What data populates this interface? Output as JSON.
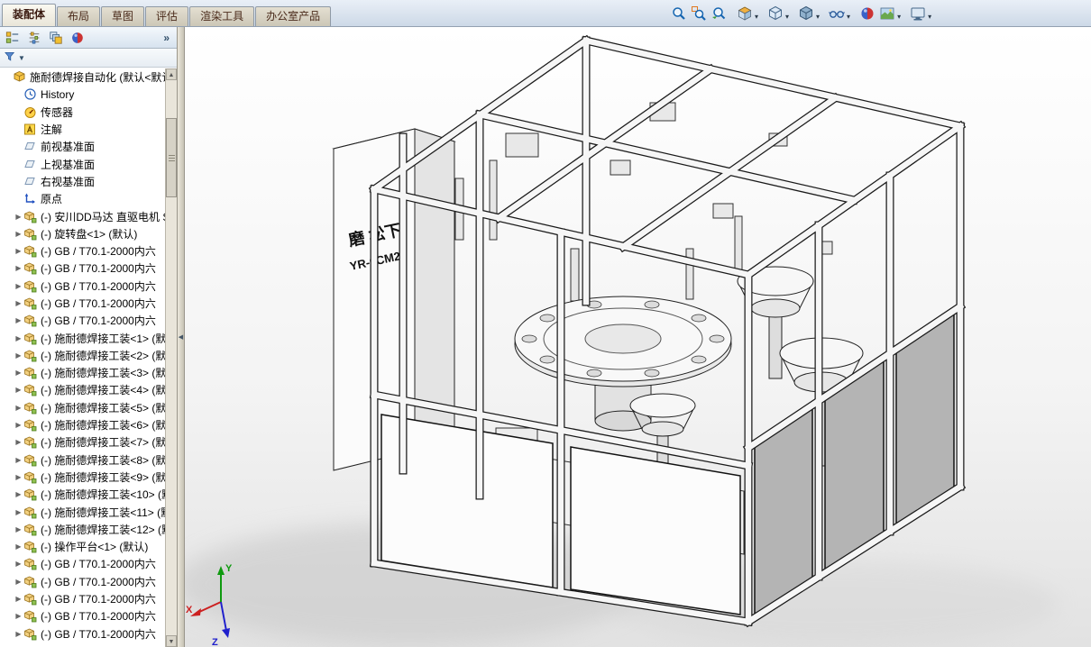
{
  "tabs": {
    "items": [
      {
        "label": "装配体",
        "active": true
      },
      {
        "label": "布局",
        "active": false
      },
      {
        "label": "草图",
        "active": false
      },
      {
        "label": "评估",
        "active": false
      },
      {
        "label": "渲染工具",
        "active": false
      },
      {
        "label": "办公室产品",
        "active": false
      }
    ]
  },
  "heads_up_toolbar": {
    "buttons": [
      {
        "icon": "zoom-fit",
        "caret": false,
        "gap": false
      },
      {
        "icon": "zoom-area",
        "caret": false,
        "gap": false
      },
      {
        "icon": "zoom-previous",
        "caret": false,
        "gap": false
      },
      {
        "icon": "section-view",
        "caret": true,
        "gap": true
      },
      {
        "icon": "view-orientation",
        "caret": true,
        "gap": true
      },
      {
        "icon": "display-style",
        "caret": true,
        "gap": true
      },
      {
        "icon": "hide-show-items",
        "caret": true,
        "gap": true
      },
      {
        "icon": "edit-appearance",
        "caret": false,
        "gap": true
      },
      {
        "icon": "apply-scene",
        "caret": true,
        "gap": false
      },
      {
        "icon": "view-settings",
        "caret": true,
        "gap": true
      }
    ]
  },
  "panel": {
    "header": {
      "icons": [
        "featuremanager-tree",
        "propertymanager",
        "configurationmanager",
        "appearance-manager"
      ],
      "overflow_label": "»"
    },
    "tree": {
      "items": [
        {
          "icon": "assembly",
          "label": "施耐德焊接自动化 (默认<默认",
          "indent": 0,
          "arrow": false
        },
        {
          "icon": "history",
          "label": "History",
          "indent": 1,
          "arrow": false
        },
        {
          "icon": "sensor",
          "label": "传感器",
          "indent": 1,
          "arrow": false
        },
        {
          "icon": "annotations",
          "label": "注解",
          "indent": 1,
          "arrow": false
        },
        {
          "icon": "plane",
          "label": "前视基准面",
          "indent": 1,
          "arrow": false
        },
        {
          "icon": "plane",
          "label": "上视基准面",
          "indent": 1,
          "arrow": false
        },
        {
          "icon": "plane",
          "label": "右视基准面",
          "indent": 1,
          "arrow": false
        },
        {
          "icon": "origin",
          "label": "原点",
          "indent": 1,
          "arrow": false
        },
        {
          "icon": "component",
          "label": "(-) 安川DD马达 直驱电机 S",
          "indent": 1,
          "arrow": true
        },
        {
          "icon": "component",
          "label": "(-) 旋转盘<1> (默认)",
          "indent": 1,
          "arrow": true
        },
        {
          "icon": "component",
          "label": "(-) GB / T70.1-2000内六",
          "indent": 1,
          "arrow": true
        },
        {
          "icon": "component",
          "label": "(-) GB / T70.1-2000内六",
          "indent": 1,
          "arrow": true
        },
        {
          "icon": "component",
          "label": "(-) GB / T70.1-2000内六",
          "indent": 1,
          "arrow": true
        },
        {
          "icon": "component",
          "label": "(-) GB / T70.1-2000内六",
          "indent": 1,
          "arrow": true
        },
        {
          "icon": "component",
          "label": "(-) GB / T70.1-2000内六",
          "indent": 1,
          "arrow": true
        },
        {
          "icon": "component",
          "label": "(-) 施耐德焊接工装<1> (默",
          "indent": 1,
          "arrow": true
        },
        {
          "icon": "component",
          "label": "(-) 施耐德焊接工装<2> (默",
          "indent": 1,
          "arrow": true
        },
        {
          "icon": "component",
          "label": "(-) 施耐德焊接工装<3> (默",
          "indent": 1,
          "arrow": true
        },
        {
          "icon": "component",
          "label": "(-) 施耐德焊接工装<4> (默",
          "indent": 1,
          "arrow": true
        },
        {
          "icon": "component",
          "label": "(-) 施耐德焊接工装<5> (默",
          "indent": 1,
          "arrow": true
        },
        {
          "icon": "component",
          "label": "(-) 施耐德焊接工装<6> (默",
          "indent": 1,
          "arrow": true
        },
        {
          "icon": "component",
          "label": "(-) 施耐德焊接工装<7> (默",
          "indent": 1,
          "arrow": true
        },
        {
          "icon": "component",
          "label": "(-) 施耐德焊接工装<8> (默",
          "indent": 1,
          "arrow": true
        },
        {
          "icon": "component",
          "label": "(-) 施耐德焊接工装<9> (默",
          "indent": 1,
          "arrow": true
        },
        {
          "icon": "component",
          "label": "(-) 施耐德焊接工装<10> (默",
          "indent": 1,
          "arrow": true
        },
        {
          "icon": "component",
          "label": "(-) 施耐德焊接工装<11> (默",
          "indent": 1,
          "arrow": true
        },
        {
          "icon": "component",
          "label": "(-) 施耐德焊接工装<12> (默",
          "indent": 1,
          "arrow": true
        },
        {
          "icon": "component",
          "label": "(-) 操作平台<1> (默认)",
          "indent": 1,
          "arrow": true
        },
        {
          "icon": "component",
          "label": "(-) GB / T70.1-2000内六",
          "indent": 1,
          "arrow": true
        },
        {
          "icon": "component",
          "label": "(-) GB / T70.1-2000内六",
          "indent": 1,
          "arrow": true
        },
        {
          "icon": "component",
          "label": "(-) GB / T70.1-2000内六",
          "indent": 1,
          "arrow": true
        },
        {
          "icon": "component",
          "label": "(-) GB / T70.1-2000内六",
          "indent": 1,
          "arrow": true
        },
        {
          "icon": "component",
          "label": "(-) GB / T70.1-2000内六",
          "indent": 1,
          "arrow": true
        }
      ]
    }
  },
  "viewport": {
    "machine_text": {
      "line1": "磨 松下",
      "line2": "YR-0CM2"
    },
    "triad": {
      "x_label": "X",
      "y_label": "Y",
      "z_label": "Z",
      "x_color": "#cc2020",
      "y_color": "#0f9a0f",
      "z_color": "#2020cc"
    }
  }
}
